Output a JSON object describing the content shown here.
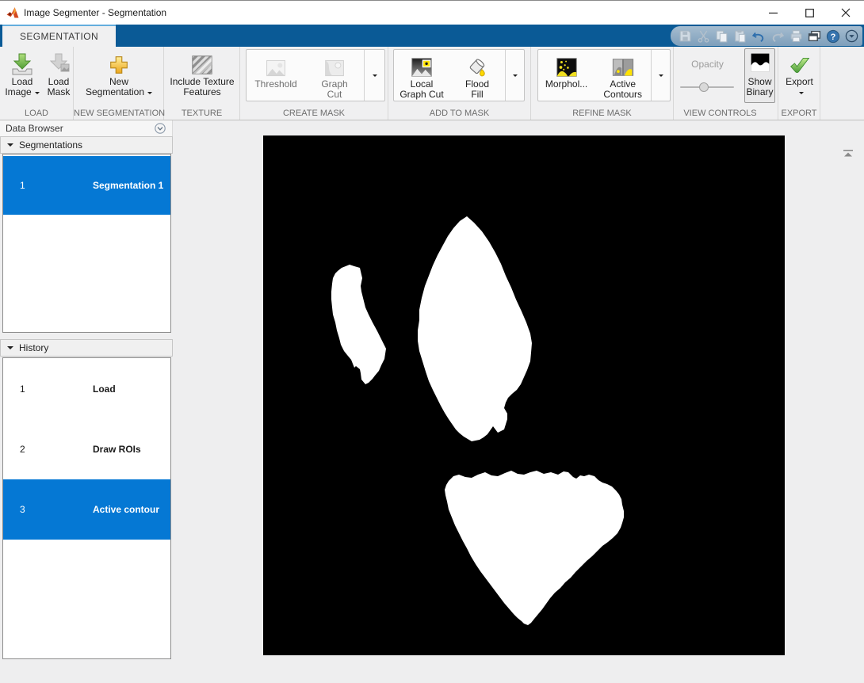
{
  "colors": {
    "selection_blue": "#0578d4",
    "tabstrip_blue": "#0a5a96",
    "ribbon_bg": "#f0f0f1",
    "canvas_bg": "#000000",
    "mask_fg": "#ffffff",
    "disabled_text": "#6e6e6e"
  },
  "window": {
    "title": "Image Segmenter - Segmentation",
    "icon": "matlab-logo"
  },
  "tab": {
    "label": "SEGMENTATION"
  },
  "quick_access": {
    "icons": [
      "save",
      "cut",
      "copy",
      "paste",
      "undo",
      "redo",
      "print",
      "layout-windows",
      "help",
      "more-menu"
    ]
  },
  "ribbon": {
    "sections": [
      {
        "label": "LOAD"
      },
      {
        "label": "NEW SEGMENTATION"
      },
      {
        "label": "TEXTURE"
      },
      {
        "label": "CREATE MASK"
      },
      {
        "label": "ADD TO MASK"
      },
      {
        "label": "REFINE MASK"
      },
      {
        "label": "VIEW CONTROLS"
      },
      {
        "label": "EXPORT"
      }
    ],
    "buttons": {
      "load_image": {
        "line1": "Load",
        "line2": "Image"
      },
      "load_mask": {
        "line1": "Load",
        "line2": "Mask"
      },
      "new_segmentation": {
        "line1": "New",
        "line2": "Segmentation"
      },
      "include_texture": {
        "line1": "Include Texture",
        "line2": "Features"
      },
      "threshold": {
        "line1": "Threshold"
      },
      "graph_cut": {
        "line1": "Graph",
        "line2": "Cut"
      },
      "local_graph_cut": {
        "line1": "Local",
        "line2": "Graph Cut"
      },
      "flood_fill": {
        "line1": "Flood",
        "line2": "Fill"
      },
      "morphology": {
        "line1": "Morphol..."
      },
      "active_contours": {
        "line1": "Active",
        "line2": "Contours"
      },
      "opacity": {
        "label": "Opacity"
      },
      "show_binary": {
        "line1": "Show",
        "line2": "Binary"
      },
      "export": {
        "line1": "Export"
      }
    }
  },
  "data_browser": {
    "title": "Data Browser",
    "segmentations": {
      "header": "Segmentations",
      "items": [
        {
          "index": "1",
          "label": "Segmentation 1",
          "selected": true
        }
      ]
    },
    "history": {
      "header": "History",
      "items": [
        {
          "index": "1",
          "label": "Load",
          "selected": false
        },
        {
          "index": "2",
          "label": "Draw ROIs",
          "selected": false
        },
        {
          "index": "3",
          "label": "Active contour",
          "selected": true
        }
      ]
    }
  },
  "canvas": {
    "type": "binary-mask-image",
    "background": "#000000",
    "foreground": "#ffffff",
    "blob_count": 3
  }
}
